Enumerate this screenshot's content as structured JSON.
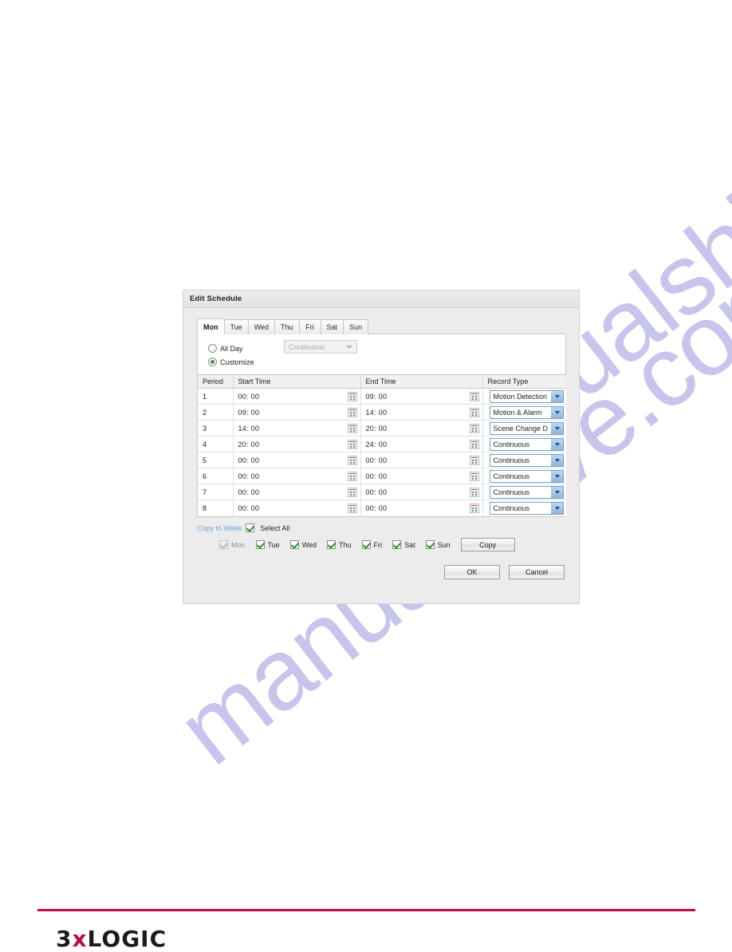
{
  "dialog": {
    "title": "Edit Schedule",
    "tabs": [
      {
        "label": "Mon",
        "active": true
      },
      {
        "label": "Tue",
        "active": false
      },
      {
        "label": "Wed",
        "active": false
      },
      {
        "label": "Thu",
        "active": false
      },
      {
        "label": "Fri",
        "active": false
      },
      {
        "label": "Sat",
        "active": false
      },
      {
        "label": "Sun",
        "active": false
      }
    ],
    "mode": {
      "all_day_label": "All Day",
      "all_day_selected": false,
      "customize_label": "Customize",
      "customize_selected": true,
      "all_day_record_type": "Continuous",
      "all_day_select_disabled": true
    },
    "table": {
      "headers": [
        "Period",
        "Start Time",
        "End Time",
        "Record Type"
      ],
      "rows": [
        {
          "period": "1",
          "start": "00: 00",
          "end": "09: 00",
          "type": "Motion Detection"
        },
        {
          "period": "2",
          "start": "09: 00",
          "end": "14: 00",
          "type": "Motion & Alarm"
        },
        {
          "period": "3",
          "start": "14: 00",
          "end": "20: 00",
          "type": "Scene Change D"
        },
        {
          "period": "4",
          "start": "20: 00",
          "end": "24: 00",
          "type": "Continuous"
        },
        {
          "period": "5",
          "start": "00: 00",
          "end": "00: 00",
          "type": "Continuous"
        },
        {
          "period": "6",
          "start": "00: 00",
          "end": "00: 00",
          "type": "Continuous"
        },
        {
          "period": "7",
          "start": "00: 00",
          "end": "00: 00",
          "type": "Continuous"
        },
        {
          "period": "8",
          "start": "00: 00",
          "end": "00: 00",
          "type": "Continuous"
        }
      ]
    },
    "copy": {
      "link_label": "Copy to Week",
      "select_all_checked": true,
      "select_all_label": "Select All",
      "days": [
        {
          "label": "Mon",
          "checked": true,
          "disabled": true
        },
        {
          "label": "Tue",
          "checked": true,
          "disabled": false
        },
        {
          "label": "Wed",
          "checked": true,
          "disabled": false
        },
        {
          "label": "Thu",
          "checked": true,
          "disabled": false
        },
        {
          "label": "Fri",
          "checked": true,
          "disabled": false
        },
        {
          "label": "Sat",
          "checked": true,
          "disabled": false
        },
        {
          "label": "Sun",
          "checked": true,
          "disabled": false
        }
      ],
      "copy_button_label": "Copy"
    },
    "footer": {
      "ok_label": "OK",
      "cancel_label": "Cancel"
    }
  },
  "watermark": {
    "text": "manualshive.com",
    "color": "#b3b0e6"
  },
  "brand": {
    "name_prefix": "3",
    "name_x": "x",
    "name_suffix": "LOGIC",
    "rule_color": "#b5123f"
  }
}
